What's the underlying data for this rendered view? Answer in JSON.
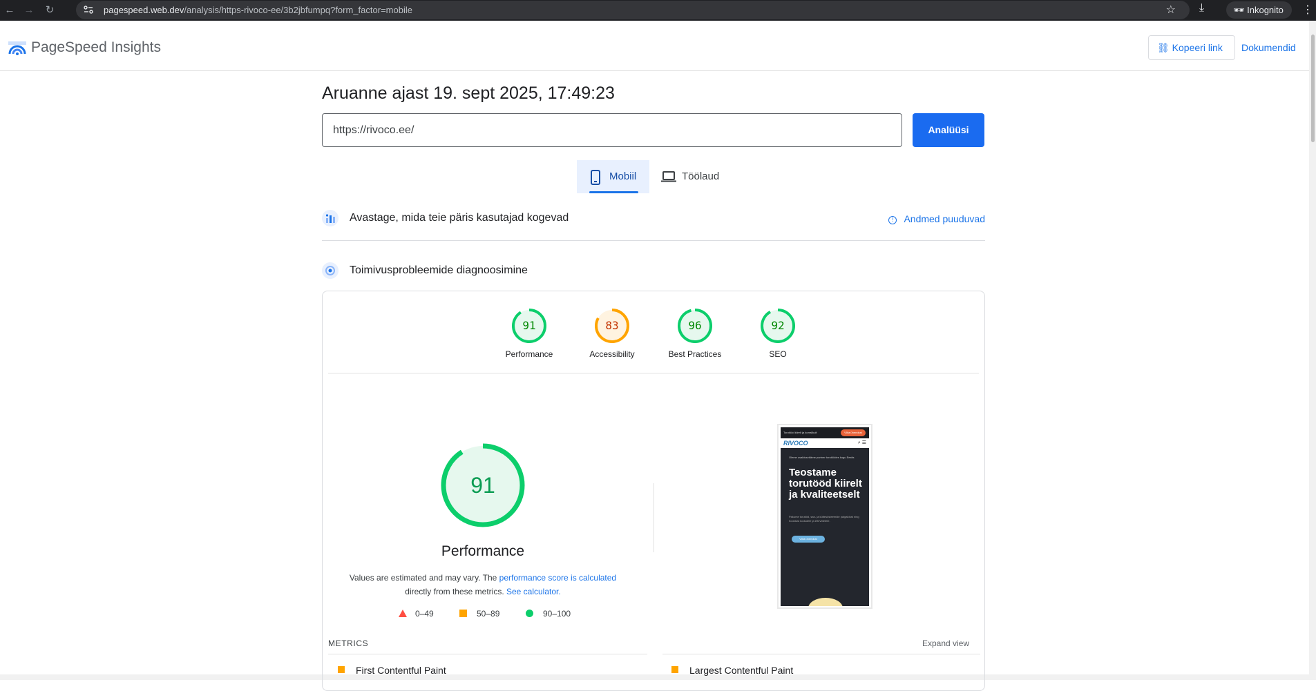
{
  "browser": {
    "url_host": "pagespeed.web.dev",
    "url_path": "/analysis/https-rivoco-ee/3b2jbfumpq?form_factor=mobile",
    "incognito_label": "Inkognito"
  },
  "header": {
    "brand": "PageSpeed Insights",
    "copy_link": "Kopeeri link",
    "docs": "Dokumendid"
  },
  "report": {
    "title": "Aruanne ajast 19. sept 2025, 17:49:23",
    "url_value": "https://rivoco.ee/",
    "analyze_label": "Analüüsi"
  },
  "tabs": [
    {
      "label": "Mobiil",
      "selected": true
    },
    {
      "label": "Töölaud",
      "selected": false
    }
  ],
  "sections": {
    "field": {
      "title": "Avastage, mida teie päris kasutajad kogevad",
      "link": "Andmed puuduvad"
    },
    "diagnose": {
      "title": "Toimivusprobleemide diagnoosimine"
    }
  },
  "scores": [
    {
      "label": "Performance",
      "value": "91",
      "level": "good"
    },
    {
      "label": "Accessibility",
      "value": "83",
      "level": "average"
    },
    {
      "label": "Best Practices",
      "value": "96",
      "level": "good"
    },
    {
      "label": "SEO",
      "value": "92",
      "level": "good"
    }
  ],
  "performance": {
    "score": "91",
    "label": "Performance",
    "desc_1": "Values are estimated and may vary. The ",
    "desc_link1": "performance score is calculated",
    "desc_2": " directly from these metrics. ",
    "desc_link2": "See calculator."
  },
  "legend": [
    {
      "range": "0–49",
      "color": "#ff4e42"
    },
    {
      "range": "50–89",
      "color": "#ffa400"
    },
    {
      "range": "90–100",
      "color": "#0cce6b"
    }
  ],
  "screenshot": {
    "topbar_text": "Torutööd kiirelt ja korralikult",
    "topbar_button": "Võta ühendust",
    "logo": "RIVOCO",
    "kicker": "Oleme usaldusväärne partner torutöödes kogu Eestis",
    "hero": "Teostame torutööd kiirelt ja kvaliteetselt",
    "small": "Pakume torutöid, san- ja küttesüsteemide paigaldust ning hooldust kodudele ja ettevõtetele.",
    "cta": "Võta ühendust"
  },
  "metrics": {
    "header": "METRICS",
    "expand": "Expand view",
    "items": [
      "First Contentful Paint",
      "Largest Contentful Paint"
    ]
  },
  "colors": {
    "good": "#0cce6b",
    "average": "#ffa400",
    "poor": "#ff4e42",
    "link": "#1a73e8"
  }
}
